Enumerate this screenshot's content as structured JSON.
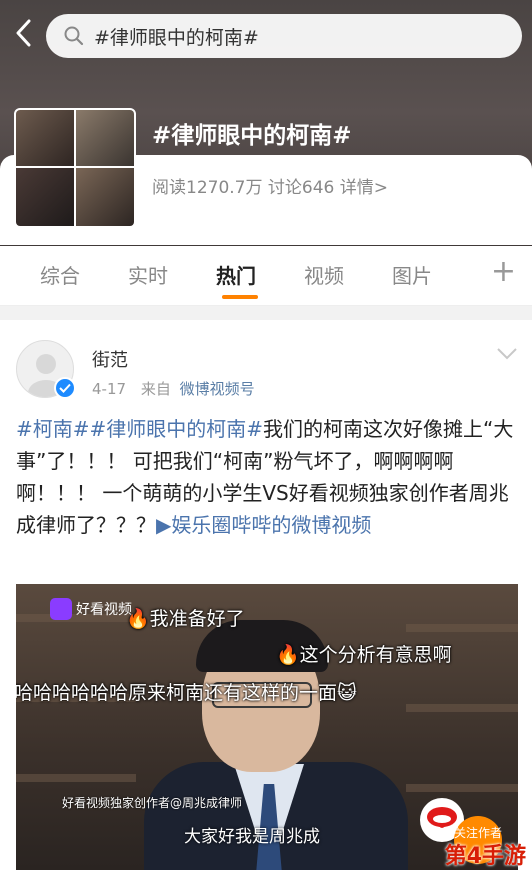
{
  "search": {
    "query": "#律师眼中的柯南#"
  },
  "topic": {
    "title": "#律师眼中的柯南#",
    "stats": "阅读1270.7万 讨论646 详情>"
  },
  "tabs": [
    {
      "label": "综合"
    },
    {
      "label": "实时"
    },
    {
      "label": "热门"
    },
    {
      "label": "视频"
    },
    {
      "label": "图片"
    }
  ],
  "post": {
    "author": "街范",
    "date": "4-17",
    "from_prefix": "来自",
    "source": "微博视频号",
    "text": {
      "tag1": "#柯南#",
      "tag2": "#律师眼中的柯南#",
      "body": "我们的柯南这次好像摊上“大事”了！！！ 可把我们“柯南”粉气坏了，啊啊啊啊啊！！！ 一个萌萌的小学生VS好看视频独家创作者周兆成律师了？？？",
      "link": "娱乐圈哔哔的微博视频"
    },
    "video": {
      "logo_text": "好看视频",
      "danmu1": "🔥我准备好了",
      "danmu2": "🔥这个分析有意思啊",
      "danmu3": "哈哈哈哈哈哈原来柯南还有这样的一面😺",
      "credit": "好看视频独家创作者@周兆成律师",
      "subtitle": "大家好我是周兆成",
      "follow_label": "关注作者"
    }
  },
  "watermark": "第4手游",
  "colors": {
    "accent": "#ff8200",
    "link": "#4b74ad",
    "verified": "#1e8bff"
  }
}
